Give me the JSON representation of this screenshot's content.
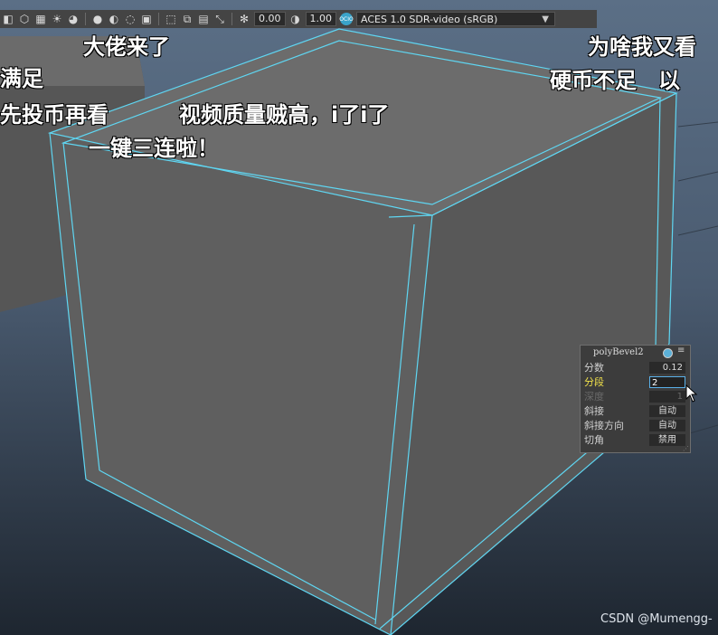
{
  "toolbar": {
    "exposure_value": "0.00",
    "gamma_value": "1.00",
    "colorspace_label": "ACES 1.0 SDR-video (sRGB)",
    "aces_badge": "OCIO"
  },
  "danmaku": [
    "大佬来了",
    "为啥我又看",
    "满足",
    "硬币不足　以",
    "先投币再看",
    "视频质量贼高，i了i了",
    "一键三连啦！"
  ],
  "bevel_panel": {
    "title": "polyBevel2",
    "rows": [
      {
        "label": "分数",
        "value": "0.12"
      },
      {
        "label": "分段",
        "value": "2"
      },
      {
        "label": "深度",
        "value": "1"
      },
      {
        "label": "斜接",
        "value": "自动"
      },
      {
        "label": "斜接方向",
        "value": "自动"
      },
      {
        "label": "切角",
        "value": "禁用"
      }
    ],
    "active_label_color": "#f0e04a"
  },
  "watermark": "CSDN @Mumengg-",
  "colors": {
    "wire": "#5fd6f2",
    "cube_top": "#6a6a6a",
    "cube_front": "#5d5d5d",
    "cube_right": "#575757"
  }
}
